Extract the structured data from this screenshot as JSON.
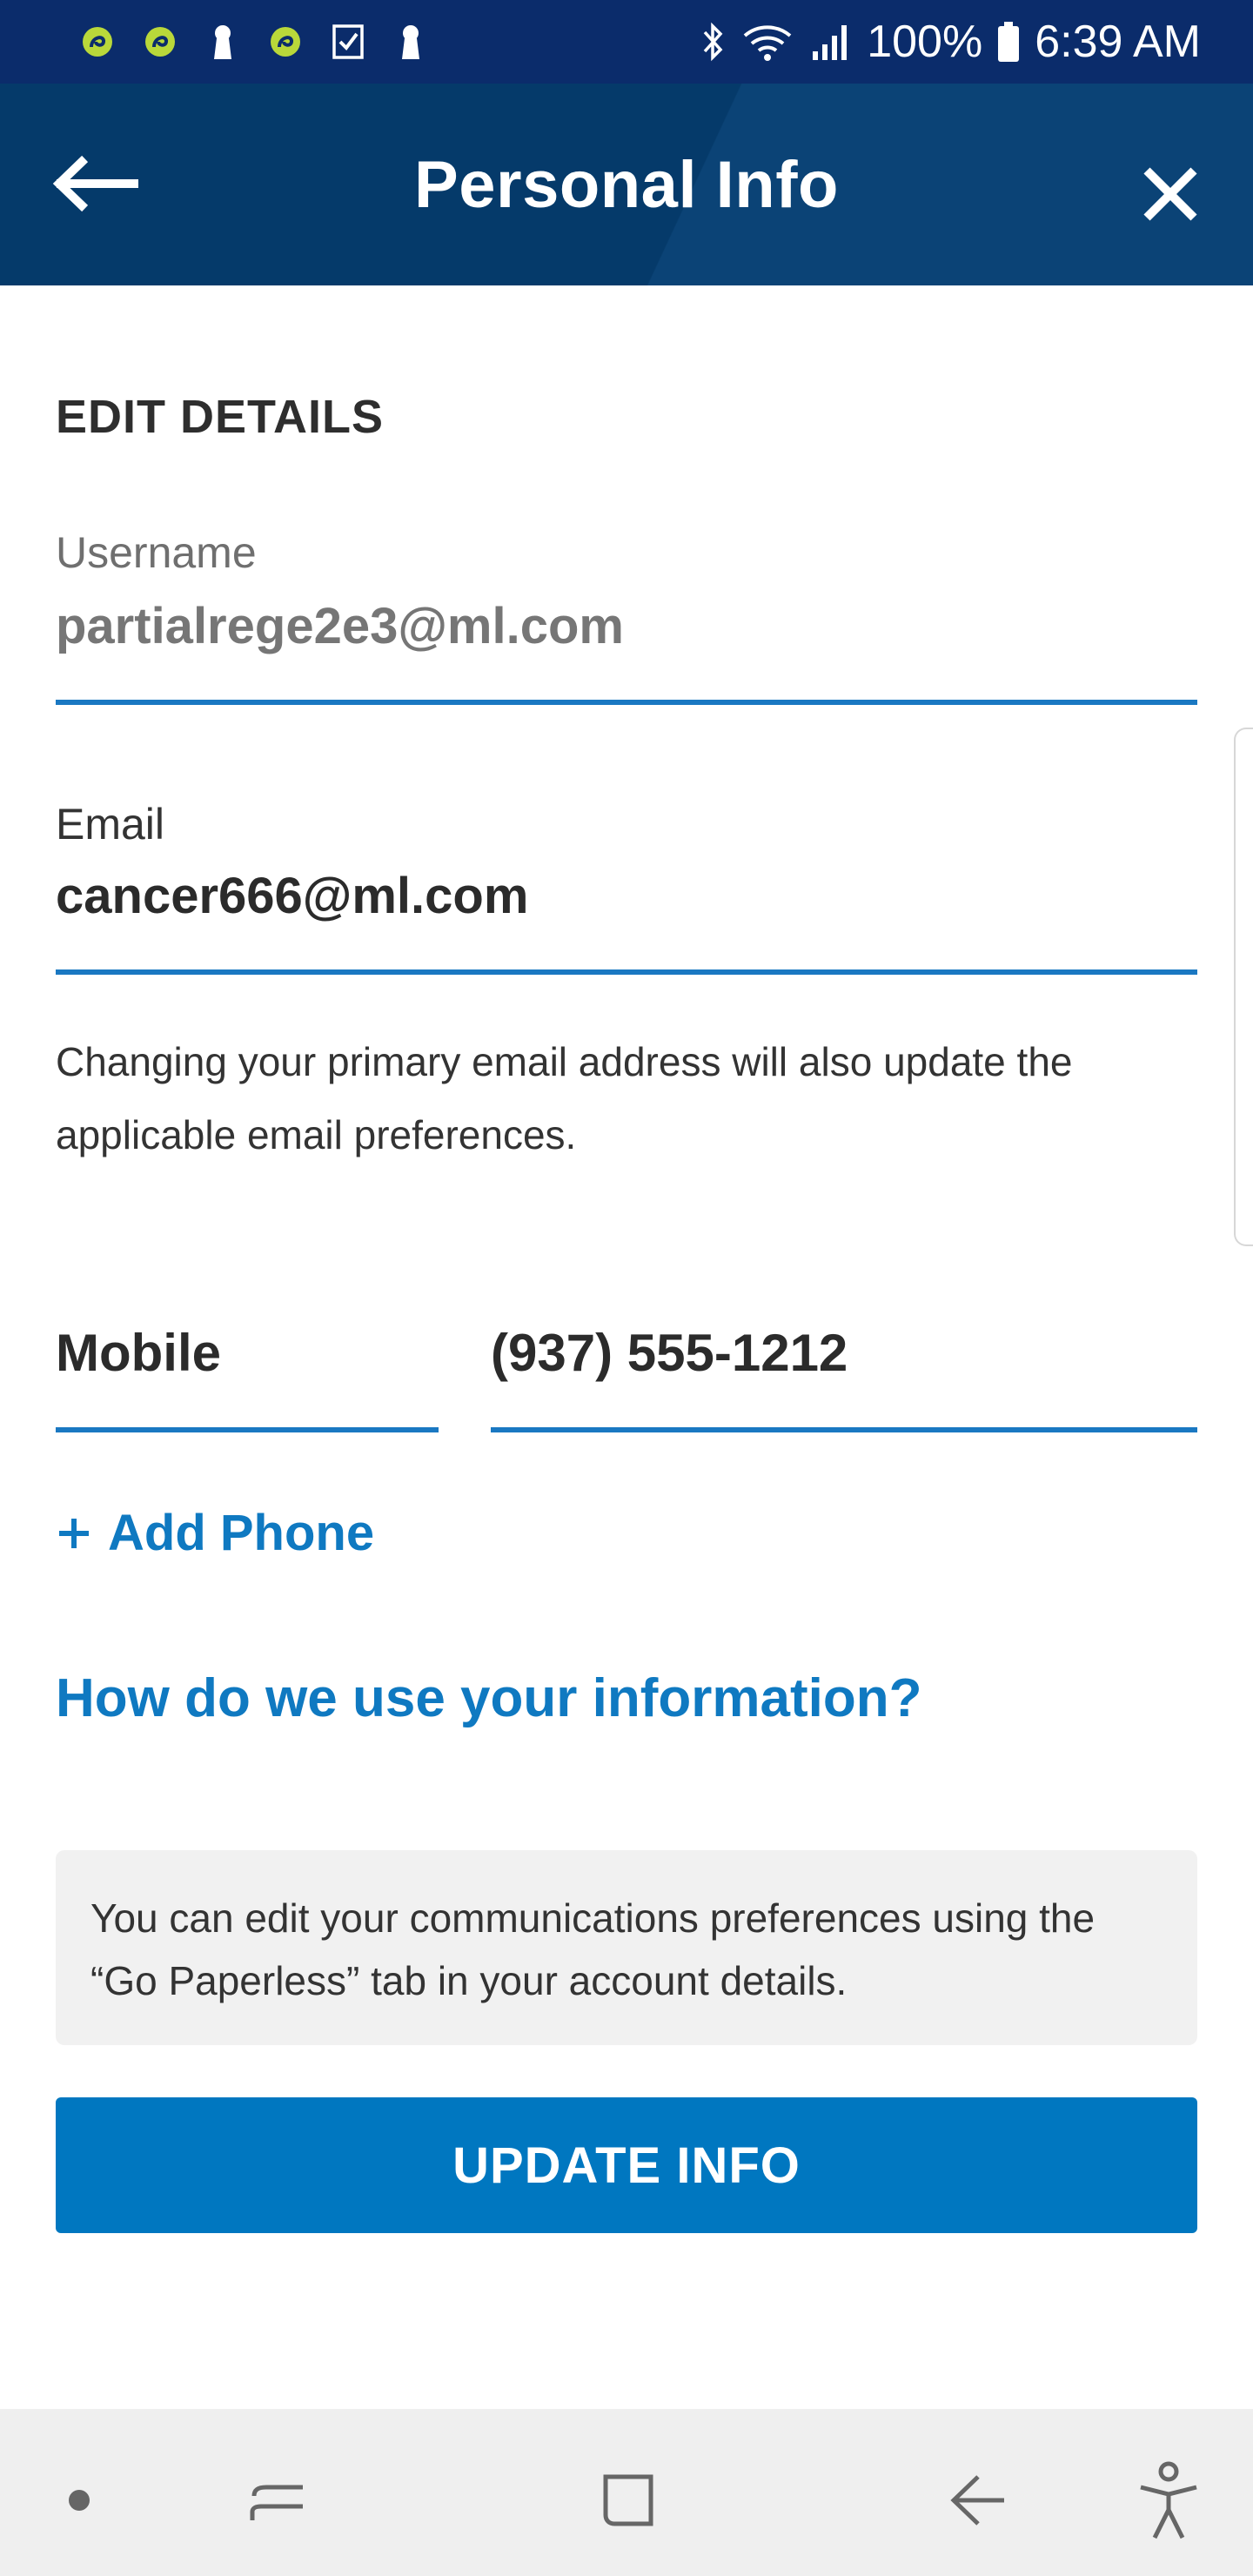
{
  "status_bar": {
    "notification_icons": [
      "app-notification-icon",
      "app-notification-icon",
      "keyhole-icon",
      "app-notification-icon",
      "checklist-icon",
      "keyhole-icon"
    ],
    "battery": "100%",
    "time": "6:39 AM"
  },
  "header": {
    "title": "Personal Info"
  },
  "form": {
    "section_heading": "EDIT DETAILS",
    "username_label": "Username",
    "username_value": "partialrege2e3@ml.com",
    "email_label": "Email",
    "email_value": "cancer666@ml.com",
    "email_helper": "Changing your primary email address will also update the applicable email preferences.",
    "phone_type": "Mobile",
    "phone_number": "(937) 555-1212",
    "add_phone_label": "Add Phone",
    "info_link": "How do we use your information?",
    "note": "You can edit your communications preferences using the “Go Paperless” tab in your account details.",
    "update_button": "UPDATE INFO"
  },
  "colors": {
    "status_bar": "#0b2c6b",
    "header": "#053a6a",
    "accent": "#0077c0",
    "link": "#0f79c1",
    "note_bg": "#f1f1f1"
  }
}
